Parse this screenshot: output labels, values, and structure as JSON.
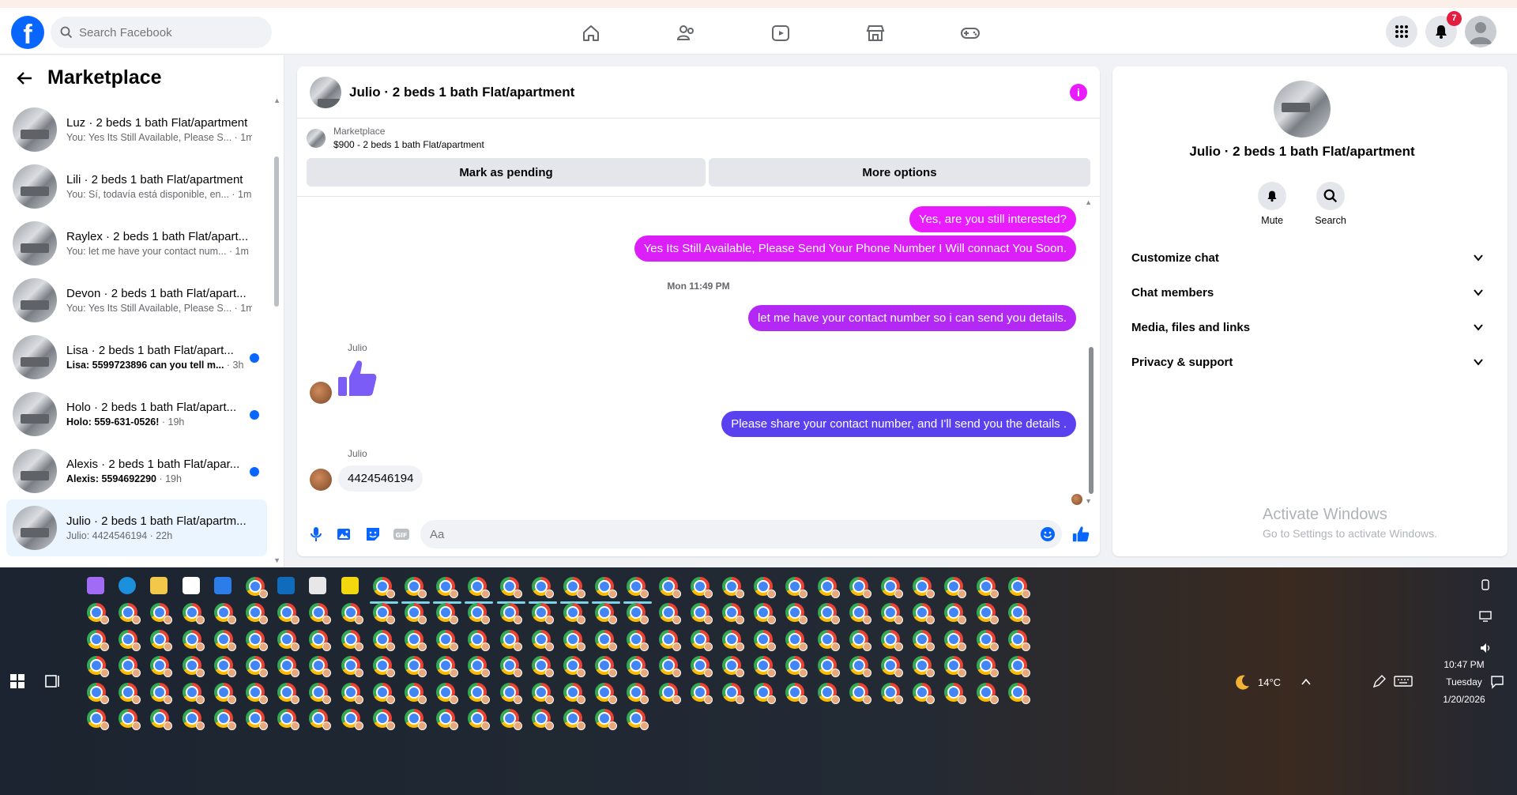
{
  "topbar": {
    "search_placeholder": "Search Facebook",
    "notifications_count": "7",
    "brand_color": "#0866ff"
  },
  "sidebar": {
    "title": "Marketplace",
    "conversations": [
      {
        "name": "Luz · 2 beds 1 bath Flat/apartment",
        "snippet": "You: Yes Its Still Available, Please S...",
        "time": " · 1m",
        "unread": false,
        "active": false
      },
      {
        "name": "Lili · 2 beds 1 bath Flat/apartment",
        "snippet": "You: Sí, todavía está disponible, en...",
        "time": " · 1m",
        "unread": false,
        "active": false
      },
      {
        "name": "Raylex · 2 beds 1 bath Flat/apart...",
        "snippet": "You: let me have your contact num...",
        "time": " · 1m",
        "unread": false,
        "active": false
      },
      {
        "name": "Devon · 2 beds 1 bath Flat/apart...",
        "snippet": "You: Yes Its Still Available, Please S...",
        "time": " · 1m",
        "unread": false,
        "active": false
      },
      {
        "name": "Lisa · 2 beds 1 bath Flat/apart...",
        "snippet": "Lisa: 5599723896 can you tell m...",
        "time": " · 3h",
        "unread": true,
        "active": false
      },
      {
        "name": "Holo · 2 beds 1 bath Flat/apart...",
        "snippet": "Holo: 559-631-0526!",
        "time": " · 19h",
        "unread": true,
        "active": false
      },
      {
        "name": "Alexis · 2 beds 1 bath Flat/apar...",
        "snippet": "Alexis: 5594692290",
        "time": " · 19h",
        "unread": true,
        "active": false
      },
      {
        "name": "Julio · 2 beds 1 bath Flat/apartm...",
        "snippet": "Julio: 4424546194",
        "time": " · 22h",
        "unread": false,
        "active": true
      }
    ]
  },
  "chat": {
    "title": "Julio · 2 beds 1 bath Flat/apartment",
    "marketplace_label": "Marketplace",
    "listing": "$900 - 2 beds 1 bath Flat/apartment",
    "mark_pending": "Mark as pending",
    "more_options": "More options",
    "messages": {
      "m1": "Yes, are you still interested?",
      "m2": "Yes Its Still Available, Please Send Your Phone Number I Will connact You Soon.",
      "timestamp": "Mon 11:49 PM",
      "m3": "let me have your contact number so i can send you details.",
      "sender1": "Julio",
      "m4": "Please share your contact number, and I'll send you the details .",
      "sender2": "Julio",
      "m5": "4424546194"
    },
    "composer_placeholder": "Aa",
    "colors": {
      "bubble_1": "#e81cff",
      "bubble_2": "#b328f5",
      "bubble_3": "#5b40f0",
      "thumb": "#7b5cf6"
    }
  },
  "rpanel": {
    "title": "Julio · 2 beds 1 bath Flat/apartment",
    "mute": "Mute",
    "search": "Search",
    "menu": [
      "Customize chat",
      "Chat members",
      "Media, files and links",
      "Privacy & support"
    ],
    "watermark_title": "Activate Windows",
    "watermark_sub": "Go to Settings to activate Windows."
  },
  "taskbar": {
    "weather": "14°C",
    "time": "10:47 PM",
    "day": "Tuesday",
    "date": "1/20/2026"
  }
}
